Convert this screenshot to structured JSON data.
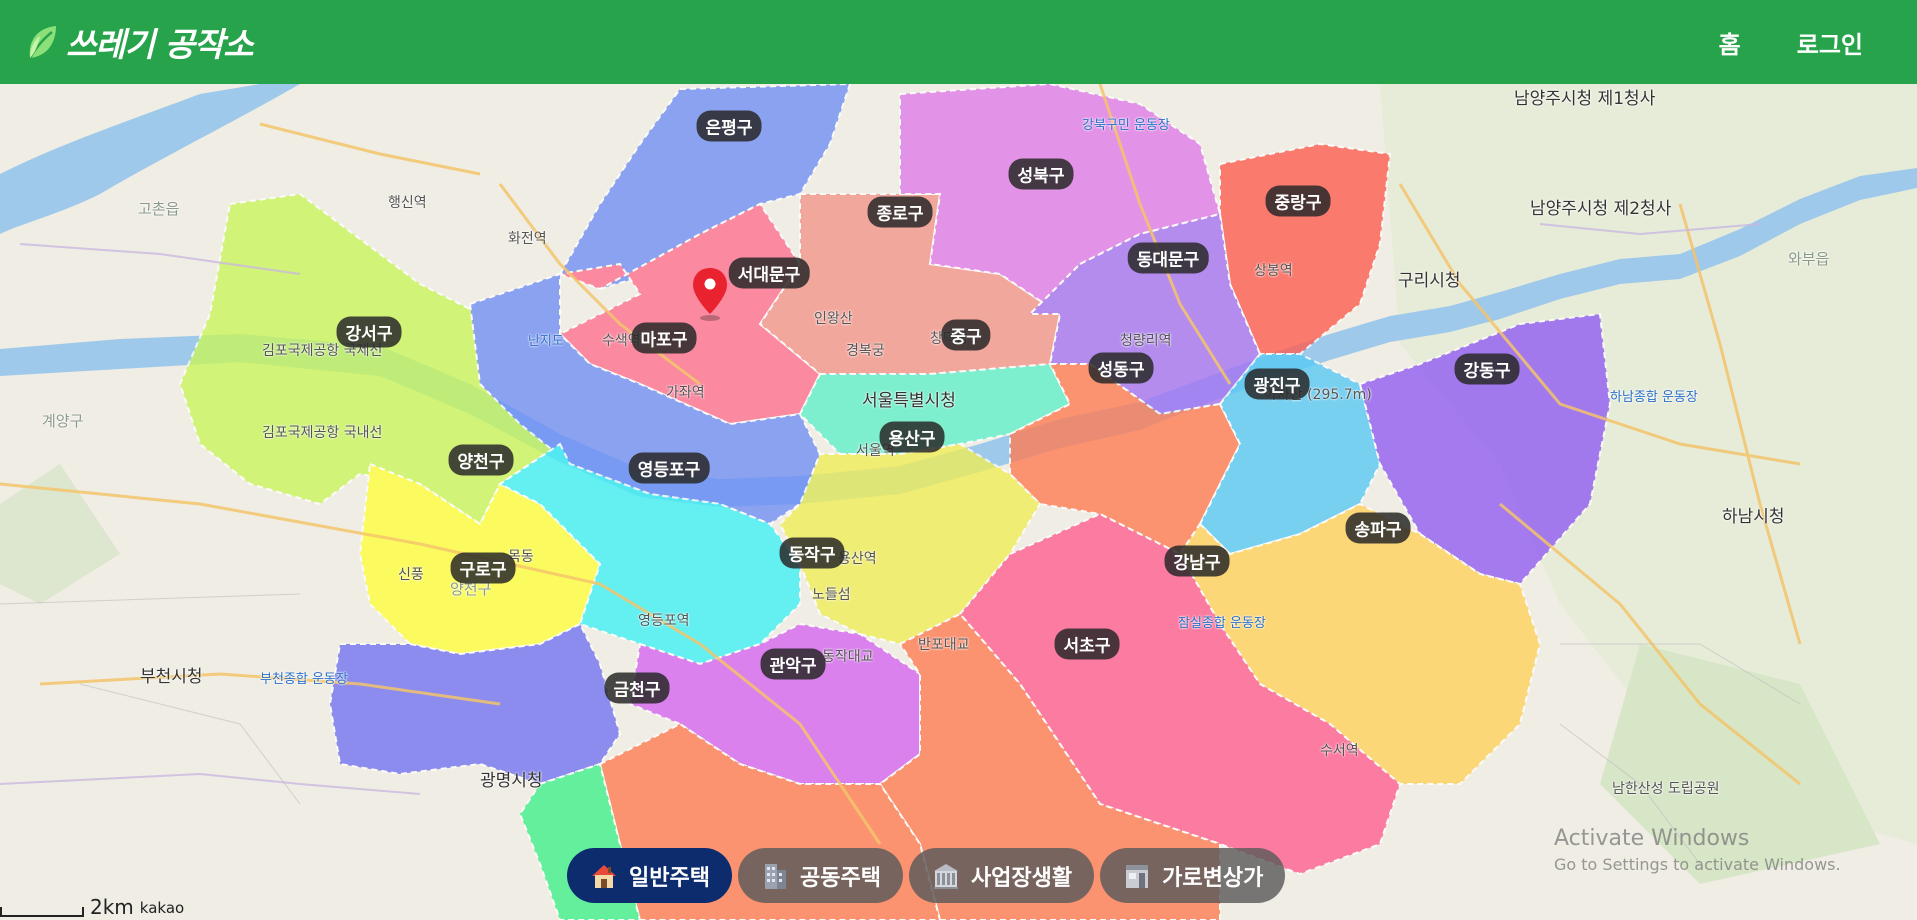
{
  "header": {
    "brand": "쓰레기 공작소",
    "nav": {
      "home": "홈",
      "login": "로그인"
    }
  },
  "map": {
    "districts": [
      {
        "label": "은평구",
        "color": "#6f8ef5"
      },
      {
        "label": "서대문구",
        "color": "#ff6f8f"
      },
      {
        "label": "종로구",
        "color": "#f3948a"
      },
      {
        "label": "성북구",
        "color": "#e07be8"
      },
      {
        "label": "중랑구",
        "color": "#ff5a4e"
      },
      {
        "label": "동대문구",
        "color": "#a472f2"
      },
      {
        "label": "강서구",
        "color": "#c8f55a"
      },
      {
        "label": "마포구",
        "color": "#6f8ef5"
      },
      {
        "label": "중구",
        "color": "#5ef0c8"
      },
      {
        "label": "성동구",
        "color": "#ff7a52"
      },
      {
        "label": "광진구",
        "color": "#57c9f5"
      },
      {
        "label": "강동구",
        "color": "#8f5af2"
      },
      {
        "label": "용산구",
        "color": "#f0ed57"
      },
      {
        "label": "양천구",
        "color": "#ffff3a"
      },
      {
        "label": "영등포구",
        "color": "#3ef0f5"
      },
      {
        "label": "송파구",
        "color": "#ffd15a"
      },
      {
        "label": "동작구",
        "color": "#d563f0"
      },
      {
        "label": "구로구",
        "color": "#6f72f0"
      },
      {
        "label": "강남구",
        "color": "#ff5c8f"
      },
      {
        "label": "서초구",
        "color": "#ff7a52"
      },
      {
        "label": "관악구",
        "color": "#ff7a52"
      },
      {
        "label": "금천구",
        "color": "#3ef08a"
      }
    ],
    "places": [
      "남양주시청 제1청사",
      "남양주시청 제2청사",
      "구리시청",
      "하남시청",
      "부천시청",
      "광명시청",
      "서울특별시청",
      "고촌읍",
      "계양구",
      "와부읍",
      "난지도",
      "수색역",
      "행신역",
      "화전역",
      "가좌역",
      "서울역",
      "용산역",
      "영등포역",
      "신풍",
      "아차산 (295.7m)",
      "남한산성 도립공원",
      "김포국제공항 국제선",
      "김포국제공항 국내선",
      "강북구민 운동장",
      "하남종합 운동장",
      "잠실종합 운동장",
      "부천종합 운동장",
      "인왕산",
      "경복궁",
      "창덕궁",
      "청량리역",
      "상봉역",
      "수서역",
      "반포대교",
      "동작대교",
      "노들섬",
      "목동",
      "양천구"
    ],
    "pin": {
      "icon": "location-pin-icon",
      "color": "#e8232f"
    }
  },
  "tabs": [
    {
      "label": "일반주택",
      "icon": "house-icon",
      "active": true
    },
    {
      "label": "공동주택",
      "icon": "apartment-icon",
      "active": false
    },
    {
      "label": "사업장생활",
      "icon": "building-icon",
      "active": false
    },
    {
      "label": "가로변상가",
      "icon": "storefront-icon",
      "active": false
    }
  ],
  "scale": {
    "distance": "2km",
    "provider": "kakao"
  },
  "watermark": {
    "title": "Activate Windows",
    "subtitle": "Go to Settings to activate Windows."
  },
  "colors": {
    "header_green": "#27a34b",
    "active_tab": "#0d2c6e",
    "inactive_tab": "#5a5a5a"
  }
}
